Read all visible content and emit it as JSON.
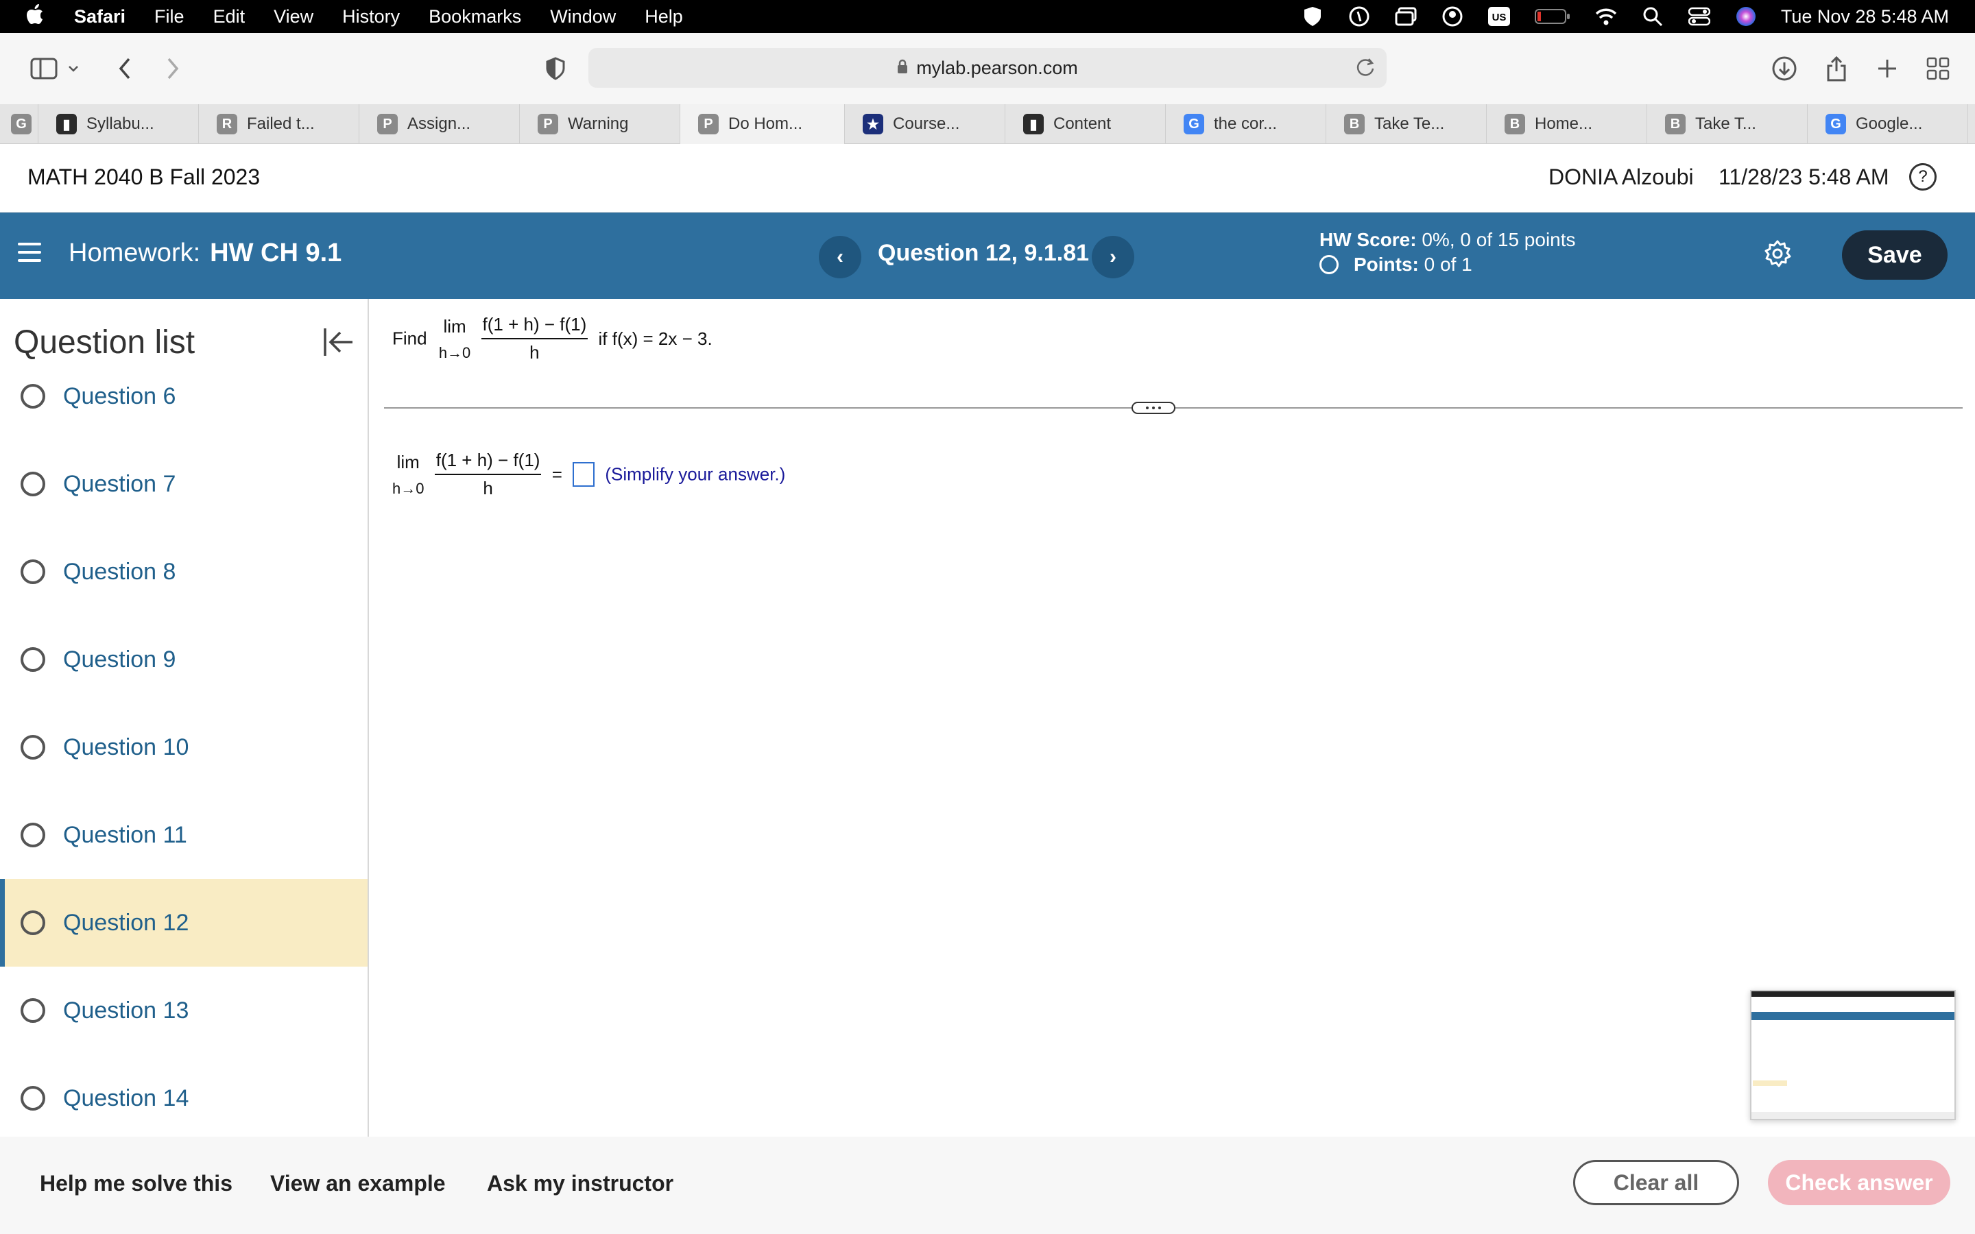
{
  "menubar": {
    "app": "Safari",
    "items": [
      "File",
      "Edit",
      "View",
      "History",
      "Bookmarks",
      "Window",
      "Help"
    ],
    "clock": "Tue Nov 28  5:48 AM"
  },
  "browser": {
    "url": "mylab.pearson.com",
    "tabs": [
      {
        "label": "",
        "fav": "G",
        "fav_color": "#8a8a8a"
      },
      {
        "label": "Syllabu...",
        "fav": "▮",
        "fav_color": "#2b2b2b"
      },
      {
        "label": "Failed t...",
        "fav": "R",
        "fav_color": "#8a8a8a"
      },
      {
        "label": "Assign...",
        "fav": "P",
        "fav_color": "#8a8a8a"
      },
      {
        "label": "Warning",
        "fav": "P",
        "fav_color": "#8a8a8a"
      },
      {
        "label": "Do Hom...",
        "fav": "P",
        "fav_color": "#8a8a8a"
      },
      {
        "label": "Course...",
        "fav": "★",
        "fav_color": "#1c2f7a"
      },
      {
        "label": "Content",
        "fav": "▮",
        "fav_color": "#2b2b2b"
      },
      {
        "label": "the cor...",
        "fav": "G",
        "fav_color": "#4285f4"
      },
      {
        "label": "Take Te...",
        "fav": "B",
        "fav_color": "#8a8a8a"
      },
      {
        "label": "Home...",
        "fav": "B",
        "fav_color": "#8a8a8a"
      },
      {
        "label": "Take T...",
        "fav": "B",
        "fav_color": "#8a8a8a"
      },
      {
        "label": "Google...",
        "fav": "G",
        "fav_color": "#4285f4"
      }
    ],
    "active_tab_index": 5
  },
  "course": {
    "title": "MATH 2040 B Fall 2023",
    "user": "DONIA Alzoubi",
    "datetime": "11/28/23 5:48 AM",
    "help_icon": "?"
  },
  "homework": {
    "prefix": "Homework:",
    "name": "HW CH 9.1",
    "question_title": "Question 12, 9.1.81",
    "prev_icon": "‹",
    "next_icon": "›",
    "score_label": "HW Score:",
    "score_value": "0%, 0 of 15 points",
    "points_label": "Points:",
    "points_value": "0 of 1",
    "save_label": "Save"
  },
  "sidebar": {
    "title": "Question list",
    "items": [
      {
        "label": "Question 6"
      },
      {
        "label": "Question 7"
      },
      {
        "label": "Question 8"
      },
      {
        "label": "Question 9"
      },
      {
        "label": "Question 10"
      },
      {
        "label": "Question 11"
      },
      {
        "label": "Question 12",
        "active": true
      },
      {
        "label": "Question 13"
      },
      {
        "label": "Question 14"
      }
    ]
  },
  "question": {
    "find": "Find",
    "lim": "lim",
    "lim_sub": "h→0",
    "numerator": "f(1 + h) − f(1)",
    "denominator": "h",
    "condition": "if f(x) = 2x − 3.",
    "equals": "=",
    "hint": "(Simplify your answer.)"
  },
  "footer": {
    "help": "Help me solve this",
    "example": "View an example",
    "instructor": "Ask my instructor",
    "clear": "Clear all",
    "check": "Check answer"
  }
}
